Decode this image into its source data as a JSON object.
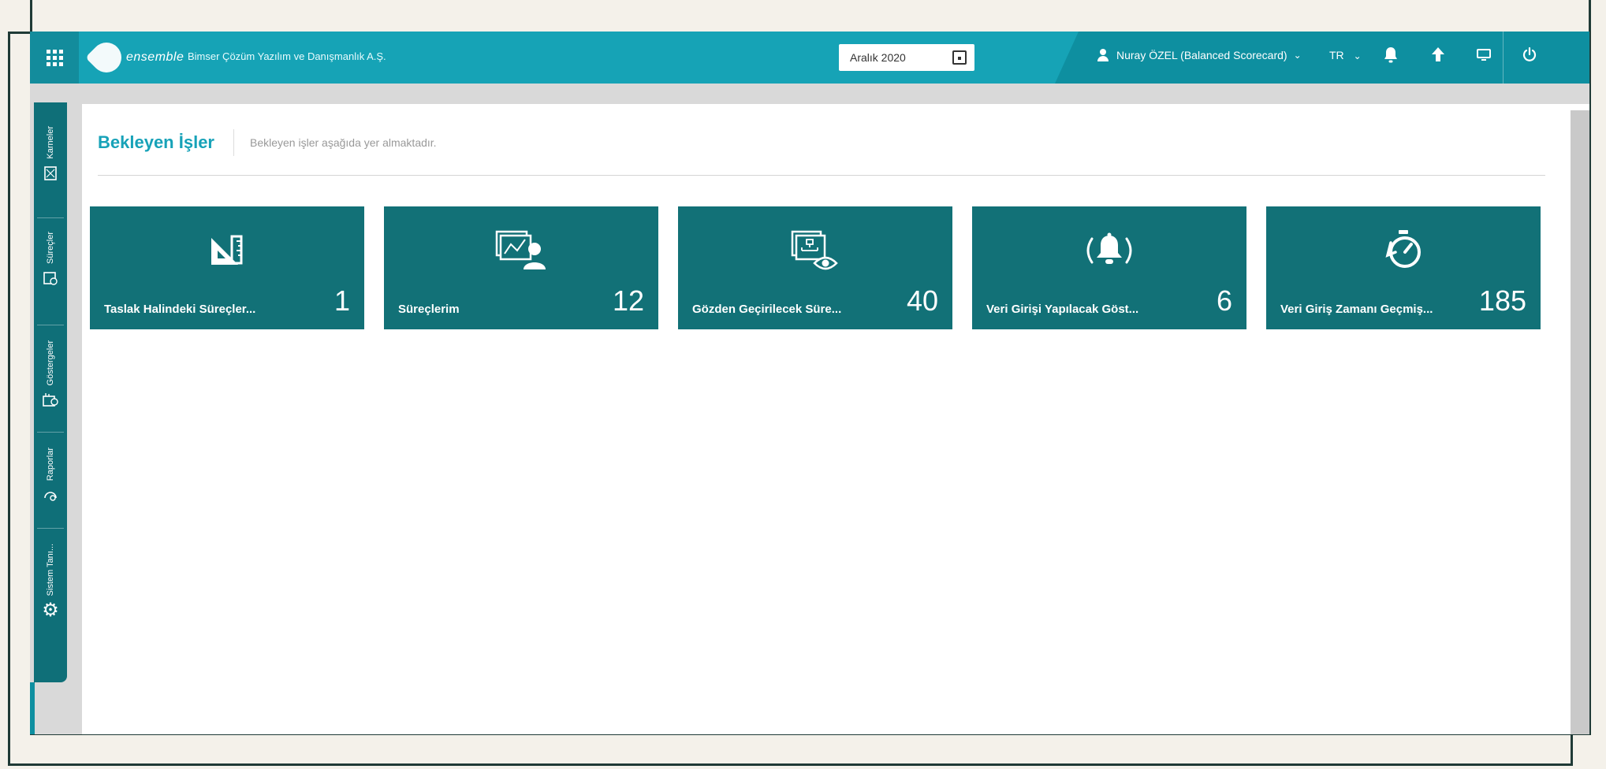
{
  "header": {
    "logo_text": "ensemble",
    "company": "Bimser Çözüm Yazılım ve Danışmanlık A.Ş.",
    "date_value": "Aralık 2020",
    "user": "Nuray ÖZEL (Balanced Scorecard)",
    "language": "TR",
    "icons": [
      "apps-grid-icon",
      "calendar-icon",
      "user-icon",
      "bell-icon",
      "arrow-up-icon",
      "screen-icon",
      "power-icon"
    ]
  },
  "sidebar": {
    "items": [
      {
        "label": "Karneler",
        "icon": "scorecard-icon"
      },
      {
        "label": "Süreçler",
        "icon": "process-icon"
      },
      {
        "label": "Göstergeler",
        "icon": "indicator-icon"
      },
      {
        "label": "Raporlar",
        "icon": "report-icon"
      },
      {
        "label": "Sistem Tanı...",
        "icon": "gear-icon"
      }
    ]
  },
  "page": {
    "title": "Bekleyen İşler",
    "subtitle": "Bekleyen işler aşağıda yer almaktadır."
  },
  "tiles": [
    {
      "label": "Taslak Halindeki Süreçler...",
      "count": "1",
      "icon": "draft-ruler-icon"
    },
    {
      "label": "Süreçlerim",
      "count": "12",
      "icon": "my-process-icon"
    },
    {
      "label": "Gözden Geçirilecek Süre...",
      "count": "40",
      "icon": "review-eye-icon"
    },
    {
      "label": "Veri Girişi Yapılacak Göst...",
      "count": "6",
      "icon": "alarm-bell-icon"
    },
    {
      "label": "Veri Giriş Zamanı Geçmiş...",
      "count": "185",
      "icon": "timer-icon"
    }
  ],
  "colors": {
    "topbar": "#16a3b6",
    "tile": "#127177",
    "accent": "#17a2b8",
    "sidebar": "#0f6f78"
  }
}
